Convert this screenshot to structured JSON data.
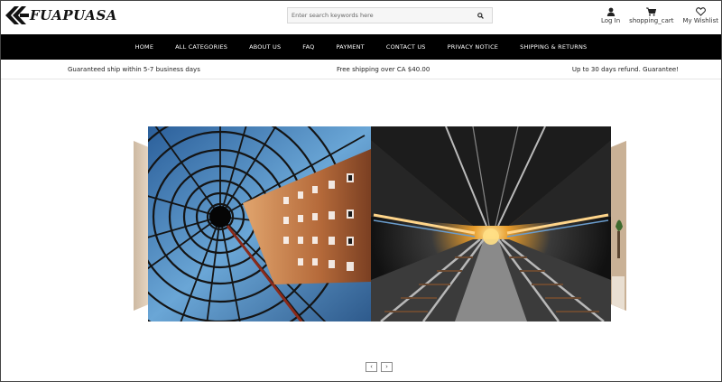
{
  "brand": {
    "name": "FUAPUASA"
  },
  "search": {
    "placeholder": "Enter search keywords here"
  },
  "header_icons": {
    "login": "Log In",
    "cart": "shopping_cart",
    "wishlist": "My Wishlist"
  },
  "nav": {
    "items": [
      "HOME",
      "ALL CATEGORIES",
      "ABOUT US",
      "FAQ",
      "PAYMENT",
      "CONTACT US",
      "PRIVACY NOTICE",
      "SHIPPING & RETURNS"
    ]
  },
  "infobar": {
    "shipping_time": "Guaranteed ship within 5-7 business days",
    "free_shipping": "Free shipping over CA $40.00",
    "refund": "Up to 30 days refund. Guarantee!"
  },
  "carousel": {
    "prev_symbol": "‹",
    "next_symbol": "›"
  },
  "icons": {
    "logo": "double-chevron-logo-icon",
    "search": "search-icon",
    "user": "user-icon",
    "cart": "cart-icon",
    "wishlist": "heart-icon"
  },
  "colors": {
    "nav_bg": "#000000",
    "nav_text": "#ffffff",
    "search_bg": "#f6f6f6"
  }
}
